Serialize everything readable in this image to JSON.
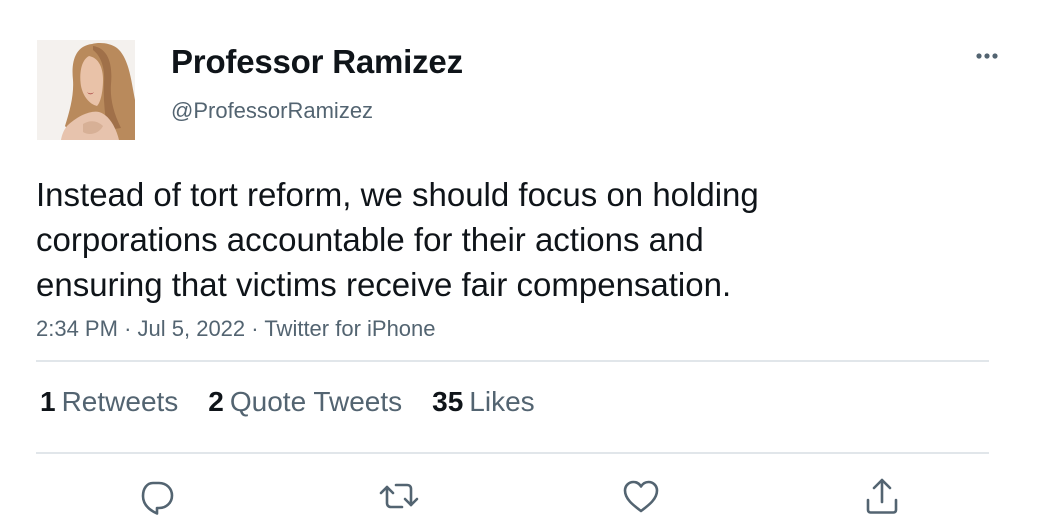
{
  "author": {
    "display_name": "Professor Ramizez",
    "handle": "@ProfessorRamizez",
    "avatar_icon": "profile-photo"
  },
  "tweet": {
    "lines": [
      "Instead of tort reform, we should focus on holding",
      "corporations accountable for their actions and",
      "ensuring that victims receive fair compensation."
    ],
    "time": "2:34 PM",
    "separator": "·",
    "date": "Jul 5, 2022",
    "source": "Twitter for iPhone"
  },
  "stats": {
    "retweets": {
      "count": "1",
      "label": "Retweets"
    },
    "quotes": {
      "count": "2",
      "label": "Quote Tweets"
    },
    "likes": {
      "count": "35",
      "label": "Likes"
    }
  },
  "actions": {
    "reply_icon": "reply-icon",
    "retweet_icon": "retweet-icon",
    "like_icon": "like-icon",
    "share_icon": "share-icon",
    "more_icon": "more-icon"
  },
  "colors": {
    "text_primary": "#0f1419",
    "text_secondary": "#536471",
    "divider": "#e1e6ea",
    "icon": "#536471"
  }
}
